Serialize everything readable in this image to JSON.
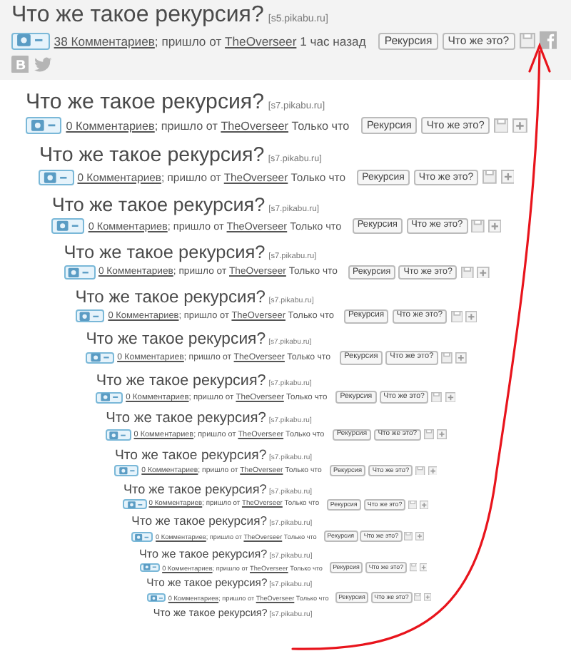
{
  "post": {
    "title": "Что же такое рекурсия?",
    "source": "[s5.pikabu.ru]",
    "highlighted": true,
    "comments": "38 Комментариев",
    "via": "; пришло от",
    "author": "TheOverseer",
    "time": "1 час назад",
    "tags": [
      "Рекурсия",
      "Что же это?"
    ],
    "share": true,
    "children": [
      {
        "title": "Что же такое рекурсия?",
        "source": "[s7.pikabu.ru]",
        "highlighted": false,
        "comments": "0 Комментариев",
        "via": "; пришло от",
        "author": "TheOverseer",
        "time": "Только что",
        "tags": [
          "Рекурсия",
          "Что же это?"
        ],
        "share": false,
        "children": [
          {
            "title": "Что же такое рекурсия?",
            "source": "[s7.pikabu.ru]",
            "highlighted": false,
            "comments": "0 Комментариев",
            "via": "; пришло от",
            "author": "TheOverseer",
            "time": "Только что",
            "tags": [
              "Рекурсия",
              "Что же это?"
            ],
            "share": false,
            "children": [
              {
                "title": "Что же такое рекурсия?",
                "source": "[s7.pikabu.ru]",
                "highlighted": false,
                "comments": "0 Комментариев",
                "via": "; пришло от",
                "author": "TheOverseer",
                "time": "Только что",
                "tags": [
                  "Рекурсия",
                  "Что же это?"
                ],
                "share": false,
                "children": [
                  {
                    "title": "Что же такое рекурсия?",
                    "source": "[s7.pikabu.ru]",
                    "highlighted": false,
                    "comments": "0 Комментариев",
                    "via": "; пришло от",
                    "author": "TheOverseer",
                    "time": "Только что",
                    "tags": [
                      "Рекурсия",
                      "Что же это?"
                    ],
                    "share": false,
                    "children": [
                      {
                        "title": "Что же такое рекурсия?",
                        "source": "[s7.pikabu.ru]",
                        "highlighted": false,
                        "comments": "0 Комментариев",
                        "via": "; пришло от",
                        "author": "TheOverseer",
                        "time": "Только что",
                        "tags": [
                          "Рекурсия",
                          "Что же это?"
                        ],
                        "share": false,
                        "children": [
                          {
                            "title": "Что же такое рекурсия?",
                            "source": "[s7.pikabu.ru]",
                            "highlighted": false,
                            "comments": "0 Комментариев",
                            "via": "; пришло от",
                            "author": "TheOverseer",
                            "time": "Только что",
                            "tags": [
                              "Рекурсия",
                              "Что же это?"
                            ],
                            "share": false,
                            "children": [
                              {
                                "title": "Что же такое рекурсия?",
                                "source": "[s7.pikabu.ru]",
                                "highlighted": false,
                                "comments": "0 Комментариев",
                                "via": "; пришло от",
                                "author": "TheOverseer",
                                "time": "Только что",
                                "tags": [
                                  "Рекурсия",
                                  "Что же это?"
                                ],
                                "share": false,
                                "children": [
                                  {
                                    "title": "Что же такое рекурсия?",
                                    "source": "[s7.pikabu.ru]",
                                    "highlighted": false,
                                    "comments": "0 Комментариев",
                                    "via": "; пришло от",
                                    "author": "TheOverseer",
                                    "time": "Только что",
                                    "tags": [
                                      "Рекурсия",
                                      "Что же это?"
                                    ],
                                    "share": false,
                                    "children": [
                                      {
                                        "title": "Что же такое рекурсия?",
                                        "source": "[s7.pikabu.ru]",
                                        "highlighted": false,
                                        "comments": "0 Комментариев",
                                        "via": "; пришло от",
                                        "author": "TheOverseer",
                                        "time": "Только что",
                                        "tags": [
                                          "Рекурсия",
                                          "Что же это?"
                                        ],
                                        "share": false,
                                        "children": [
                                          {
                                            "title": "Что же такое рекурсия?",
                                            "source": "[s7.pikabu.ru]",
                                            "highlighted": false,
                                            "comments": "0 Комментариев",
                                            "via": "; пришло от",
                                            "author": "TheOverseer",
                                            "time": "Только что",
                                            "tags": [
                                              "Рекурсия",
                                              "Что же это?"
                                            ],
                                            "share": false,
                                            "children": [
                                              {
                                                "title": "Что же такое рекурсия?",
                                                "source": "[s7.pikabu.ru]",
                                                "highlighted": false,
                                                "comments": "0 Комментариев",
                                                "via": "; пришло от",
                                                "author": "TheOverseer",
                                                "time": "Только что",
                                                "tags": [
                                                  "Рекурсия",
                                                  "Что же это?"
                                                ],
                                                "share": false,
                                                "children": [
                                                  {
                                                    "title": "Что же такое рекурсия?",
                                                    "source": "[s7.pikabu.ru]",
                                                    "highlighted": false,
                                                    "comments": "0 Комментариев",
                                                    "via": "; пришло от",
                                                    "author": "TheOverseer",
                                                    "time": "Только что",
                                                    "tags": [
                                                      "Рекурсия",
                                                      "Что же это?"
                                                    ],
                                                    "share": false,
                                                    "children": [
                                                      {
                                                        "title": "Что же такое рекурсия?",
                                                        "source": "[s7.pikabu.ru]",
                                                        "highlighted": false,
                                                        "comments": "0 Комментариев",
                                                        "via": "; пришло от",
                                                        "author": "TheOverseer",
                                                        "time": "Только что",
                                                        "tags": [
                                                          "Рекурсия",
                                                          "Что же это?"
                                                        ],
                                                        "share": false,
                                                        "children": [
                                                          {
                                                            "title": "Что же такое рекурсия?",
                                                            "source": "[s7.pikabu.ru]",
                                                            "highlighted": false
                                                          }
                                                        ]
                                                      }
                                                    ]
                                                  }
                                                ]
                                              }
                                            ]
                                          }
                                        ]
                                      }
                                    ]
                                  }
                                ]
                              }
                            ]
                          }
                        ]
                      }
                    ]
                  }
                ]
              }
            ]
          }
        ]
      }
    ]
  }
}
